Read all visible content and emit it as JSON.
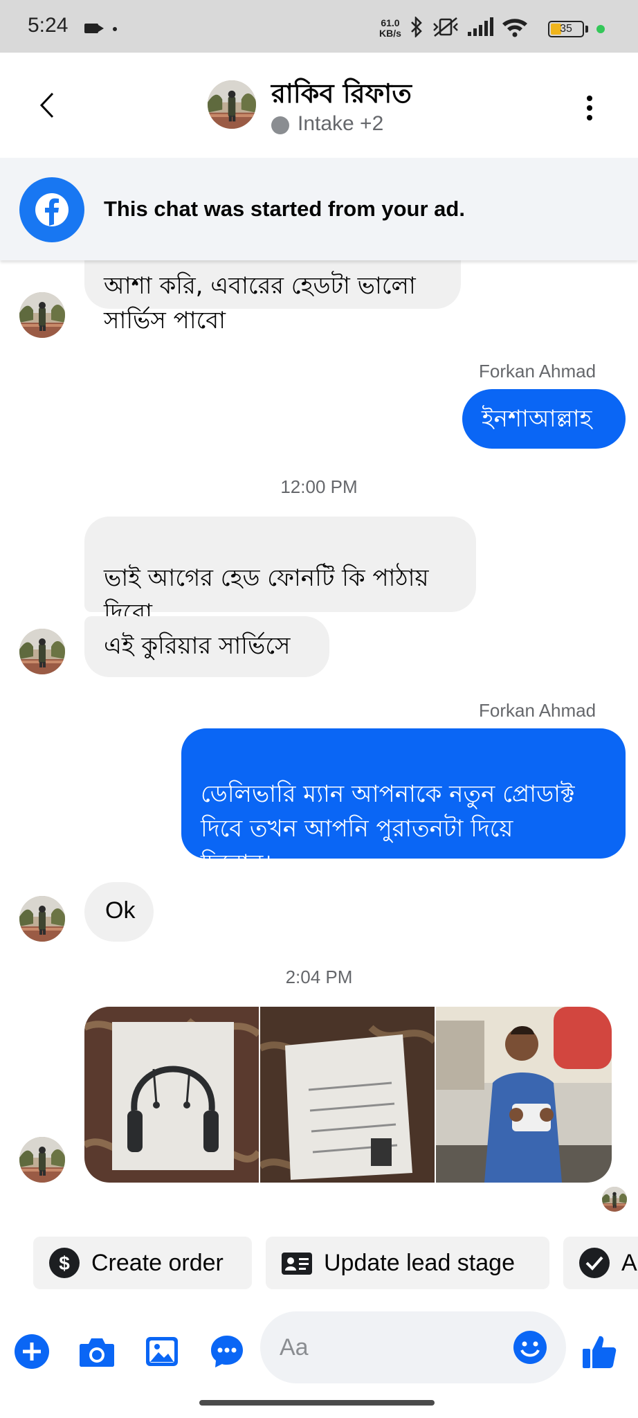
{
  "status_bar": {
    "time": "5:24",
    "net_speed_value": "61.0",
    "net_speed_unit": "KB/s",
    "battery_level": "35",
    "battery_fraction": 0.35
  },
  "header": {
    "contact_name": "রাকিব রিফাত",
    "subtitle": "Intake +2"
  },
  "ad_banner": {
    "text": "This chat was started from your ad."
  },
  "messages": {
    "m1_partial": "আশা করি, এবারের হেডটা ভালো\nসার্ভিস পাবো",
    "m2_sender": "Forkan Ahmad",
    "m2_text": "ইনশাআল্লাহ",
    "time_1": "12:00 PM",
    "m3_text": "ভাই আগের হেড ফোনটি কি পাঠায়\nদিবো,",
    "m4_text": "এই কুরিয়ার সার্ভিসে",
    "m5_sender": "Forkan Ahmad",
    "m5_text": "ডেলিভারি ম্যান আপনাকে নতুন প্রোডাক্ট\nদিবে তখন আপনি পুরাতনটা দিয়ে\nদিবোন।",
    "m6_text": "Ok",
    "time_2": "2:04 PM"
  },
  "quick_actions": {
    "create_order": "Create order",
    "update_lead_stage": "Update lead stage",
    "third_partial": "A"
  },
  "composer": {
    "placeholder": "Aa"
  },
  "colors": {
    "accent": "#0a66f5",
    "incoming_bubble": "#f0f0f0",
    "status_bar_bg": "#d9d9d9",
    "banner_bg": "#f2f4f7",
    "facebook_blue": "#1877f2"
  },
  "icons": {
    "back": "chevron-left-icon",
    "more": "kebab-icon",
    "ad_logo": "facebook-icon",
    "create_order": "dollar-icon",
    "update_lead": "id-card-icon",
    "third_chip": "check-icon",
    "add": "plus-icon",
    "camera": "camera-icon",
    "gallery": "image-icon",
    "more_chat": "chat-bubble-icon",
    "emoji": "emoji-icon",
    "like": "thumbs-up-icon"
  }
}
